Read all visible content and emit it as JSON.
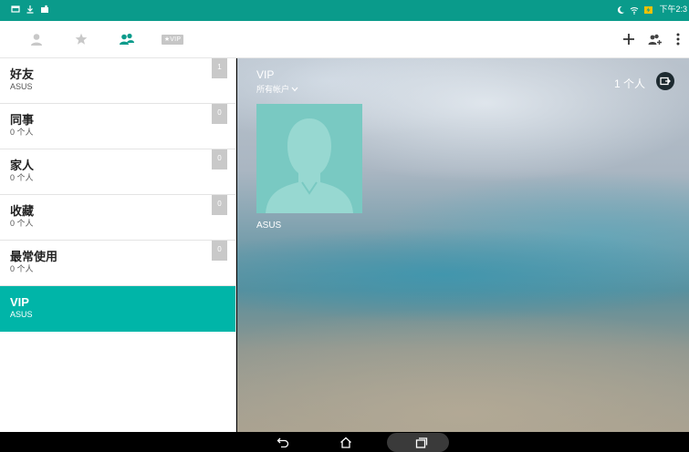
{
  "status_bar": {
    "time": "下午2:3",
    "icons": [
      "notification-icon",
      "download-icon",
      "photo-icon",
      "moon-icon",
      "wifi-icon",
      "battery-charging-icon"
    ]
  },
  "toolbar": {
    "tabs": [
      {
        "name": "contacts-tab",
        "icon": "person-icon"
      },
      {
        "name": "favorites-tab",
        "icon": "star-icon"
      },
      {
        "name": "groups-tab",
        "icon": "group-icon",
        "active": true
      },
      {
        "name": "vip-tab",
        "label": "★VIP"
      }
    ],
    "actions": [
      "add-icon",
      "add-group-icon",
      "more-icon"
    ]
  },
  "sidebar": {
    "items": [
      {
        "name": "好友",
        "sub": "ASUS",
        "count": "1"
      },
      {
        "name": "同事",
        "sub": "0 个人",
        "count": "0"
      },
      {
        "name": "家人",
        "sub": "0 个人",
        "count": "0"
      },
      {
        "name": "收藏",
        "sub": "0 个人",
        "count": "0"
      },
      {
        "name": "最常使用",
        "sub": "0 个人",
        "count": "0"
      },
      {
        "name": "VIP",
        "sub": "ASUS",
        "selected": true
      }
    ]
  },
  "main": {
    "title": "VIP",
    "account_filter": "所有帐户",
    "member_count": "1 个人",
    "contacts": [
      {
        "name": "ASUS"
      }
    ]
  },
  "colors": {
    "accent": "#0a9b8b",
    "selected": "#00b5a8",
    "avatar_bg": "#79c9c2"
  }
}
